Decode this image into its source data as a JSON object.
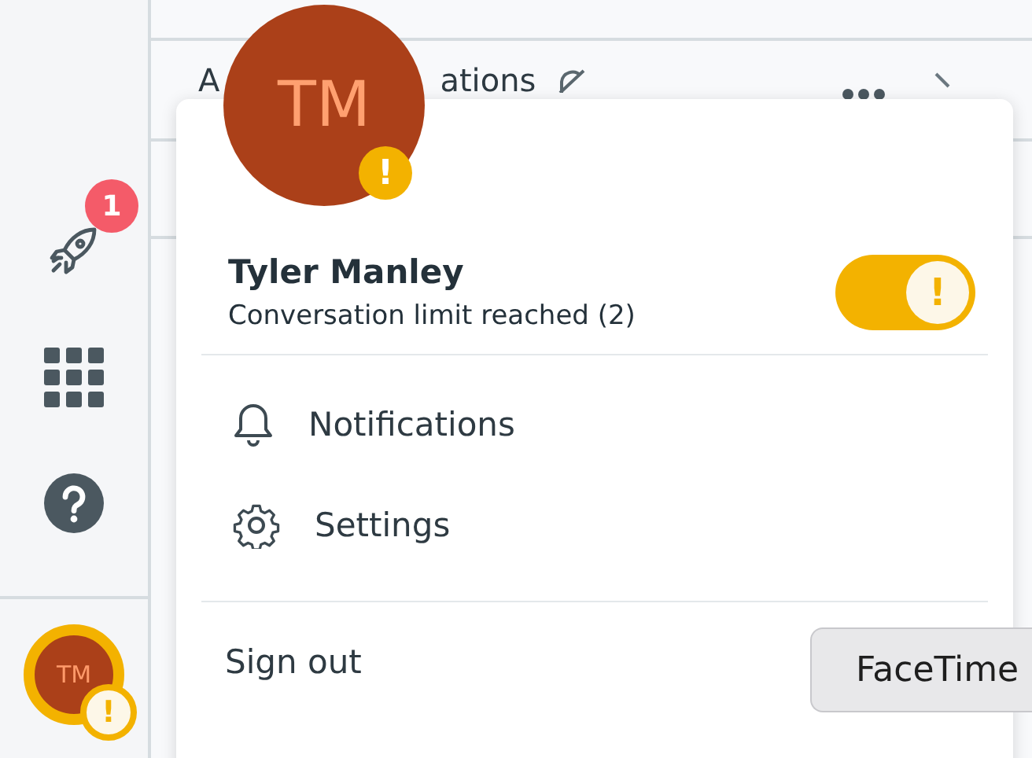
{
  "sidebar": {
    "updates_badge": "1",
    "avatar": {
      "initials": "TM",
      "alert": "!"
    }
  },
  "header": {
    "title_start": "A",
    "title_end": "ations"
  },
  "profile_menu": {
    "avatar": {
      "initials": "TM",
      "alert": "!"
    },
    "name": "Tyler Manley",
    "status": "Conversation limit reached (2)",
    "toggle": {
      "on": true,
      "mark": "!"
    },
    "items": [
      {
        "kind": "notifications",
        "label": "Notifications"
      },
      {
        "kind": "settings",
        "label": "Settings"
      }
    ],
    "sign_out": "Sign out"
  },
  "tooltip": "FaceTime"
}
